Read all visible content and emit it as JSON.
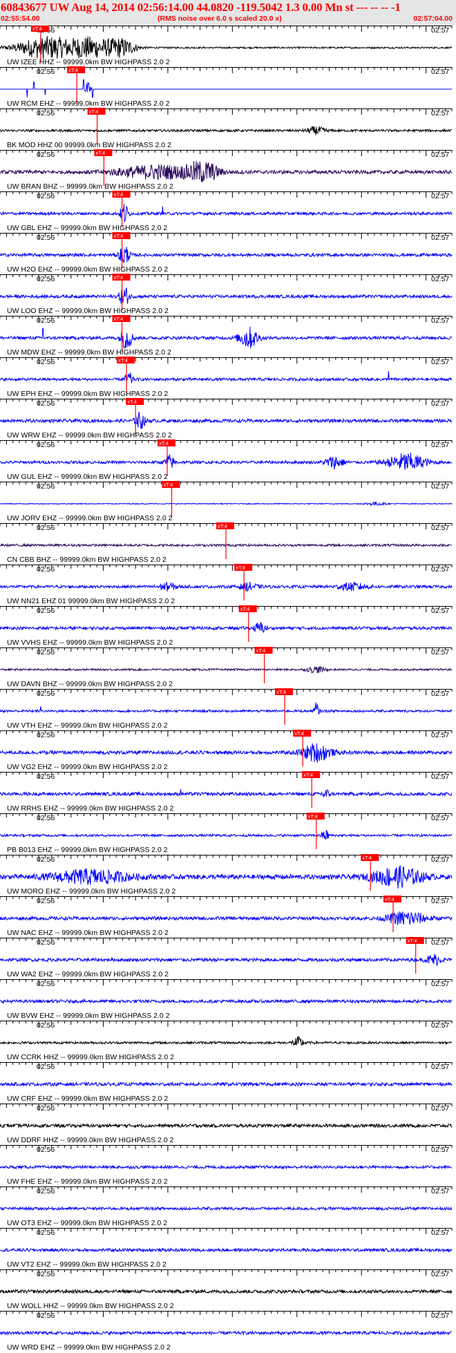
{
  "header": {
    "title": "60843677 UW Aug 14, 2014 02:56:14.00   44.0820 -119.5042  1.3 0.00 Mn st --- -- --   -1",
    "start_time": "02:55:54.00",
    "scaling_note": "(RMS noise over 6.0 s scaled 20.0 x)",
    "end_time": "02:57:04.00"
  },
  "colors": {
    "header_text": "#ff0000",
    "header_bg": "#e6e6e6",
    "trace_blue": "#0000ff",
    "trace_black": "#000000",
    "trace_purple": "#2a0a5a",
    "pick": "#ff0000"
  },
  "chart_data": {
    "type": "line",
    "x_range": [
      "02:55:54.00",
      "02:57:04.00"
    ],
    "minute_ticks": [
      "02:56",
      "02:57"
    ],
    "pick_label": "xT:4",
    "traces": [
      {
        "station": "UW IZEE HHZ -- 99999.0km BW  HIGHPASS  2.0  2",
        "color": "#000000",
        "pick": 0.09,
        "noise": 0.07,
        "bursts": [
          [
            0.1,
            0.06,
            0.95
          ],
          [
            0.2,
            0.05,
            0.85
          ],
          [
            0.27,
            0.03,
            0.7
          ]
        ],
        "spikes": []
      },
      {
        "station": "UW RCM EHZ -- 99999.0km BW  HIGHPASS  2.0  2",
        "color": "#0000ff",
        "pick": 0.17,
        "noise": 0.0,
        "bursts": [
          [
            0.195,
            0.008,
            0.6
          ]
        ],
        "spikes": [
          [
            0.06,
            -0.7
          ],
          [
            0.075,
            0.6
          ],
          [
            0.1,
            -0.5
          ],
          [
            0.185,
            0.8
          ],
          [
            0.205,
            -0.7
          ]
        ]
      },
      {
        "station": "BK MOD HHZ 00 99999.0km BW  HIGHPASS  2.0  2",
        "color": "#000000",
        "pick": 0.215,
        "noise": 0.1,
        "bursts": [
          [
            0.7,
            0.02,
            0.3
          ]
        ],
        "spikes": []
      },
      {
        "station": "UW BRAN BHZ -- 99999.0km BW  HIGHPASS  2.0  2",
        "color": "#2a0a5a",
        "pick": 0.23,
        "noise": 0.15,
        "bursts": [
          [
            0.35,
            0.09,
            0.55
          ],
          [
            0.45,
            0.03,
            0.9
          ]
        ],
        "spikes": []
      },
      {
        "station": "UW GBL EHZ -- 99999.0km BW  HIGHPASS  2.0  2",
        "color": "#0000ff",
        "pick": 0.27,
        "noise": 0.12,
        "bursts": [
          [
            0.275,
            0.008,
            0.95
          ]
        ],
        "spikes": [
          [
            0.36,
            0.6
          ]
        ]
      },
      {
        "station": "UW H2O EHZ -- 99999.0km BW  HIGHPASS  2.0  2",
        "color": "#0000ff",
        "pick": 0.27,
        "noise": 0.13,
        "bursts": [
          [
            0.275,
            0.01,
            0.95
          ]
        ],
        "spikes": []
      },
      {
        "station": "UW LOO EHZ -- 99999.0km BW  HIGHPASS  2.0  2",
        "color": "#0000ff",
        "pick": 0.27,
        "noise": 0.13,
        "bursts": [
          [
            0.275,
            0.01,
            0.85
          ]
        ],
        "spikes": []
      },
      {
        "station": "UW MDW EHZ -- 99999.0km BW  HIGHPASS  2.0  2",
        "color": "#0000ff",
        "pick": 0.27,
        "noise": 0.13,
        "bursts": [
          [
            0.28,
            0.012,
            0.95
          ],
          [
            0.55,
            0.02,
            0.9
          ]
        ],
        "spikes": [
          [
            0.095,
            0.8
          ]
        ]
      },
      {
        "station": "UW EPH EHZ -- 99999.0km BW  HIGHPASS  2.0  2",
        "color": "#0000ff",
        "pick": 0.28,
        "noise": 0.12,
        "bursts": [
          [
            0.285,
            0.008,
            0.6
          ]
        ],
        "spikes": [
          [
            0.86,
            0.7
          ]
        ]
      },
      {
        "station": "UW WRW EHZ -- 99999.0km BW  HIGHPASS  2.0  2",
        "color": "#0000ff",
        "pick": 0.3,
        "noise": 0.14,
        "bursts": [
          [
            0.31,
            0.01,
            0.7
          ]
        ],
        "spikes": []
      },
      {
        "station": "UW GUL EHZ -- 99999.0km BW  HIGHPASS  2.0  2",
        "color": "#0000ff",
        "pick": 0.37,
        "noise": 0.12,
        "bursts": [
          [
            0.375,
            0.01,
            0.6
          ],
          [
            0.74,
            0.02,
            0.5
          ],
          [
            0.9,
            0.04,
            0.75
          ]
        ],
        "spikes": []
      },
      {
        "station": "UW JORV EHZ -- 99999.0km BW  HIGHPASS  2.0  2",
        "color": "#0000ff",
        "pick": 0.38,
        "noise": 0.04,
        "bursts": [
          [
            0.83,
            0.02,
            0.15
          ]
        ],
        "spikes": []
      },
      {
        "station": "CN CBB BHZ -- 99999.0km BW  HIGHPASS  2.0  2",
        "color": "#2a0a5a",
        "pick": 0.5,
        "noise": 0.1,
        "bursts": [],
        "spikes": []
      },
      {
        "station": "UW NN21 EHZ 01 99999.0km BW  HIGHPASS  2.0  2",
        "color": "#0000ff",
        "pick": 0.54,
        "noise": 0.12,
        "bursts": [
          [
            0.37,
            0.02,
            0.3
          ],
          [
            0.55,
            0.02,
            0.3
          ],
          [
            0.78,
            0.03,
            0.3
          ]
        ],
        "spikes": []
      },
      {
        "station": "UW VVHS EHZ -- 99999.0km BW  HIGHPASS  2.0  2",
        "color": "#0000ff",
        "pick": 0.55,
        "noise": 0.13,
        "bursts": [
          [
            0.575,
            0.012,
            0.45
          ]
        ],
        "spikes": []
      },
      {
        "station": "UW DAVN BHZ -- 99999.0km BW  HIGHPASS  2.0  2",
        "color": "#2a0a5a",
        "pick": 0.585,
        "noise": 0.08,
        "bursts": [
          [
            0.7,
            0.02,
            0.25
          ]
        ],
        "spikes": []
      },
      {
        "station": "UW VTH EHZ -- 99999.0km BW  HIGHPASS  2.0  2",
        "color": "#0000ff",
        "pick": 0.63,
        "noise": 0.1,
        "bursts": [
          [
            0.7,
            0.005,
            0.8
          ]
        ],
        "spikes": [
          [
            0.09,
            0.4
          ]
        ]
      },
      {
        "station": "UW VG2 EHZ -- 99999.0km BW  HIGHPASS  2.0  2",
        "color": "#0000ff",
        "pick": 0.67,
        "noise": 0.15,
        "bursts": [
          [
            0.7,
            0.03,
            0.75
          ]
        ],
        "spikes": []
      },
      {
        "station": "UW RRHS EHZ -- 99999.0km BW  HIGHPASS  2.0  2",
        "color": "#0000ff",
        "pick": 0.69,
        "noise": 0.14,
        "bursts": [
          [
            0.72,
            0.008,
            0.4
          ]
        ],
        "spikes": [
          [
            0.4,
            0.4
          ]
        ]
      },
      {
        "station": "PB B013 EHZ -- 99999.0km BW  HIGHPASS  2.0  2",
        "color": "#0000ff",
        "pick": 0.7,
        "noise": 0.1,
        "bursts": [
          [
            0.72,
            0.008,
            0.45
          ]
        ],
        "spikes": []
      },
      {
        "station": "UW MORO EHZ -- 99999.0km BW  HIGHPASS  2.0  2",
        "color": "#0000ff",
        "pick": 0.82,
        "noise": 0.2,
        "bursts": [
          [
            0.2,
            0.08,
            0.55
          ],
          [
            0.88,
            0.05,
            0.85
          ]
        ],
        "spikes": []
      },
      {
        "station": "UW NAC EHZ -- 99999.0km BW  HIGHPASS  2.0  2",
        "color": "#0000ff",
        "pick": 0.87,
        "noise": 0.14,
        "bursts": [
          [
            0.9,
            0.04,
            0.6
          ]
        ],
        "spikes": []
      },
      {
        "station": "UW WA2 EHZ -- 99999.0km BW  HIGHPASS  2.0  2",
        "color": "#0000ff",
        "pick": 0.92,
        "noise": 0.14,
        "bursts": [
          [
            0.96,
            0.015,
            0.45
          ]
        ],
        "spikes": []
      },
      {
        "station": "UW BVW EHZ -- 99999.0km BW  HIGHPASS  2.0  2",
        "color": "#0000ff",
        "pick": null,
        "noise": 0.13,
        "bursts": [],
        "spikes": []
      },
      {
        "station": "UW CCRK HHZ -- 99999.0km BW  HIGHPASS  2.0  2",
        "color": "#000000",
        "pick": null,
        "noise": 0.1,
        "bursts": [
          [
            0.66,
            0.012,
            0.45
          ]
        ],
        "spikes": []
      },
      {
        "station": "UW CRF EHZ -- 99999.0km BW  HIGHPASS  2.0  2",
        "color": "#0000ff",
        "pick": null,
        "noise": 0.14,
        "bursts": [],
        "spikes": []
      },
      {
        "station": "UW DDRF HHZ -- 99999.0km BW  HIGHPASS  2.0  2",
        "color": "#000000",
        "pick": null,
        "noise": 0.14,
        "bursts": [],
        "spikes": []
      },
      {
        "station": "UW FHE EHZ -- 99999.0km BW  HIGHPASS  2.0  2",
        "color": "#0000ff",
        "pick": null,
        "noise": 0.12,
        "bursts": [],
        "spikes": []
      },
      {
        "station": "UW OT3 EHZ -- 99999.0km BW  HIGHPASS  2.0  2",
        "color": "#0000ff",
        "pick": null,
        "noise": 0.12,
        "bursts": [],
        "spikes": []
      },
      {
        "station": "UW VT2 EHZ -- 99999.0km BW  HIGHPASS  2.0  2",
        "color": "#0000ff",
        "pick": null,
        "noise": 0.13,
        "bursts": [],
        "spikes": []
      },
      {
        "station": "UW WOLL HHZ -- 99999.0km BW  HIGHPASS  2.0  2",
        "color": "#000000",
        "pick": null,
        "noise": 0.14,
        "bursts": [],
        "spikes": []
      },
      {
        "station": "UW WRD EHZ -- 99999.0km BW  HIGHPASS  2.0  2",
        "color": "#0000ff",
        "pick": null,
        "noise": 0.13,
        "bursts": [],
        "spikes": []
      }
    ]
  }
}
